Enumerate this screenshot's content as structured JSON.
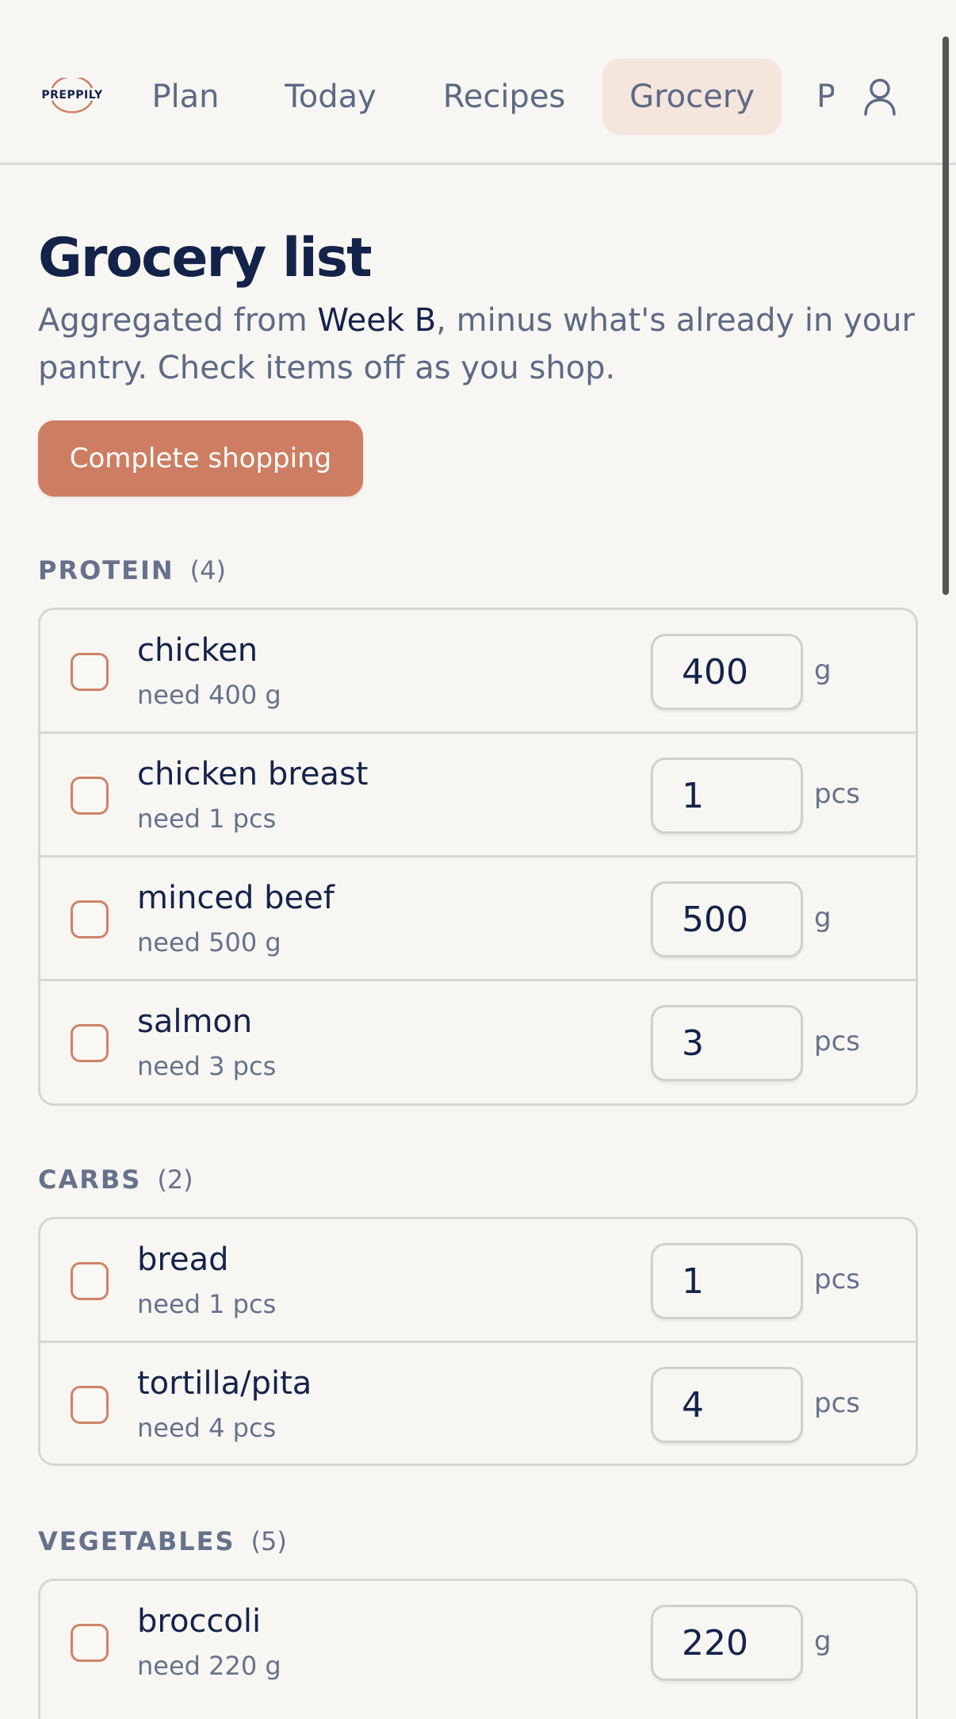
{
  "brand": {
    "logo_text": "PREPPILY"
  },
  "nav": {
    "tabs": [
      {
        "label": "Plan"
      },
      {
        "label": "Today"
      },
      {
        "label": "Recipes"
      },
      {
        "label": "Grocery",
        "active": true
      },
      {
        "label": "P"
      }
    ]
  },
  "page": {
    "title": "Grocery list",
    "subtitle_prefix": "Aggregated from ",
    "subtitle_week": "Week B",
    "subtitle_suffix": ", minus what's already in your pantry. Check items off as you shop.",
    "complete_label": "Complete shopping"
  },
  "sections": [
    {
      "label": "PROTEIN",
      "count": "(4)",
      "items": [
        {
          "name": "chicken",
          "need": "need 400 g",
          "qty": "400",
          "unit": "g"
        },
        {
          "name": "chicken breast",
          "need": "need 1 pcs",
          "qty": "1",
          "unit": "pcs"
        },
        {
          "name": "minced beef",
          "need": "need 500 g",
          "qty": "500",
          "unit": "g"
        },
        {
          "name": "salmon",
          "need": "need 3 pcs",
          "qty": "3",
          "unit": "pcs"
        }
      ]
    },
    {
      "label": "CARBS",
      "count": "(2)",
      "items": [
        {
          "name": "bread",
          "need": "need 1 pcs",
          "qty": "1",
          "unit": "pcs"
        },
        {
          "name": "tortilla/pita",
          "need": "need 4 pcs",
          "qty": "4",
          "unit": "pcs"
        }
      ]
    },
    {
      "label": "VEGETABLES",
      "count": "(5)",
      "items": [
        {
          "name": "broccoli",
          "need": "need 220 g",
          "qty": "220",
          "unit": "g"
        }
      ]
    }
  ],
  "colors": {
    "accent": "#cd7e62",
    "active_tab_bg": "#f4e5dd",
    "text_primary": "#14234a",
    "text_muted": "#5d6a85",
    "background": "#f8f6f2"
  }
}
